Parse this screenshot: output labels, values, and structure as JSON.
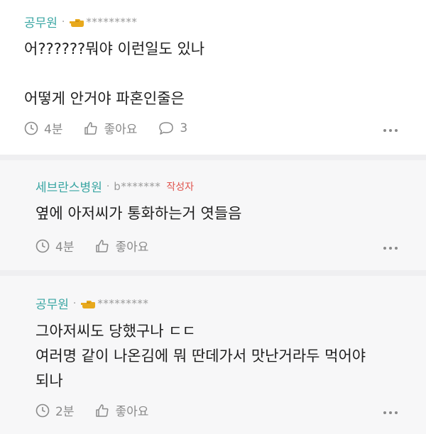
{
  "comments": [
    {
      "author": "공무원",
      "dot": "·",
      "badge_icon": "hand-pointing-icon",
      "masked_id": "*********",
      "body": "어??????뭐야 이런일도 있나\n\n어떻게 안거야 파혼인줄은",
      "time": "4분",
      "like_label": "좋아요",
      "reply_count": "3"
    },
    {
      "author": "세브란스병원",
      "dot": "·",
      "masked_id": "b*******",
      "op_label": "작성자",
      "body": "옆에 아저씨가 통화하는거 엿들음",
      "time": "4분",
      "like_label": "좋아요"
    },
    {
      "author": "공무원",
      "dot": "·",
      "badge_icon": "hand-pointing-icon",
      "masked_id": "*********",
      "body": "그아저씨도 당했구나 ㄷㄷ\n여러명 같이 나온김에 뭐 딴데가서 맛난거라두 먹어야\n되나",
      "time": "2분",
      "like_label": "좋아요"
    }
  ],
  "colors": {
    "author": "#3aa6a3",
    "op_badge": "#e0544e",
    "meta_gray": "#8a8a8a",
    "reply_bg": "#f7f7f8",
    "badge_gold": "#e8a91c"
  }
}
